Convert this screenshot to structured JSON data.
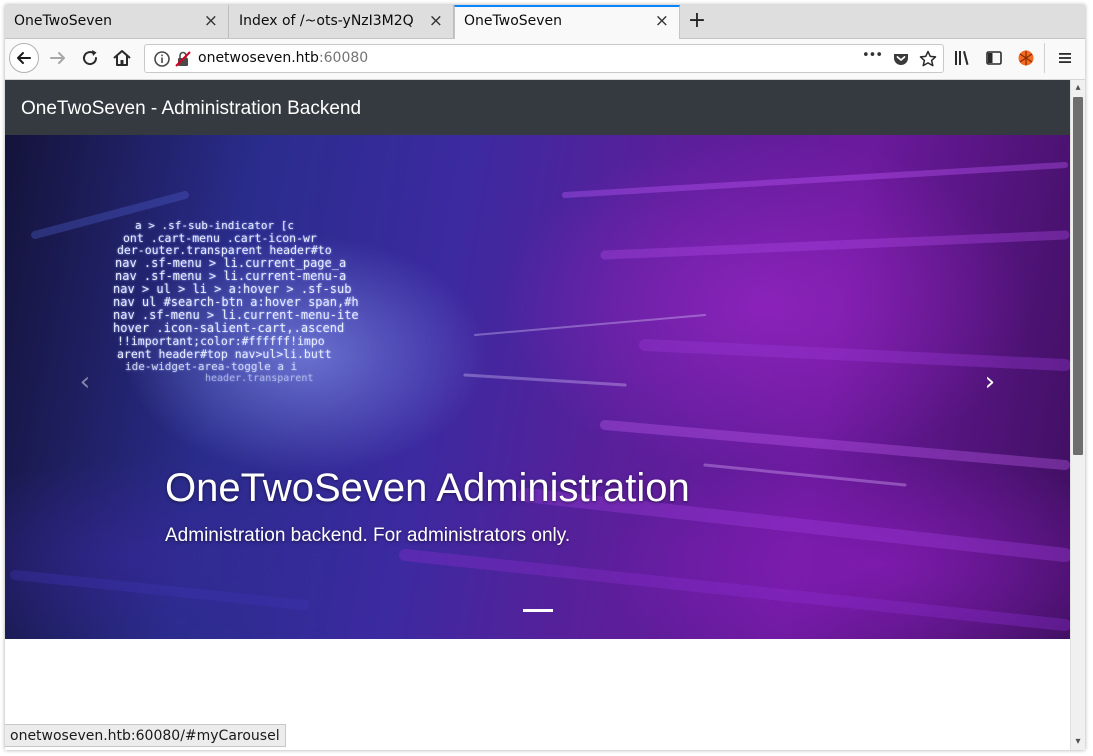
{
  "tabs": [
    {
      "title": "OneTwoSeven",
      "close": "×"
    },
    {
      "title": "Index of /~ots-yNzI3M2Q",
      "close": "×"
    },
    {
      "title": "OneTwoSeven",
      "close": "×"
    }
  ],
  "new_tab": "+",
  "urlbar": {
    "host": "onetwoseven.htb",
    "port": ":60080",
    "more": "•••"
  },
  "page": {
    "brand": "OneTwoSeven - Administration Backend",
    "carousel": {
      "title": "OneTwoSeven Administration",
      "subtitle": "Administration backend. For administrators only.",
      "prev": "‹",
      "next": "›",
      "code_lines": [
        "a > .sf-sub-indicator [c",
        "ont .cart-menu .cart-icon-wr",
        "der-outer.transparent header#to",
        "nav .sf-menu > li.current_page_a",
        "nav .sf-menu > li.current-menu-a",
        "nav > ul > li > a:hover > .sf-sub",
        "nav ul #search-btn a:hover span,#h",
        "nav .sf-menu > li.current-menu-ite",
        "hover .icon-salient-cart,.ascend",
        "!!important;color:#ffffff!impo",
        "arent header#top nav>ul>li.butt",
        "ide-widget-area-toggle a i",
        "header.transparent"
      ]
    }
  },
  "status": {
    "text": "onetwoseven.htb:60080/#myCarousel"
  },
  "scroll": {
    "up": "▴",
    "down": "▾"
  },
  "colors": {
    "accent": "#0a84ff",
    "navbar": "#343a40"
  }
}
